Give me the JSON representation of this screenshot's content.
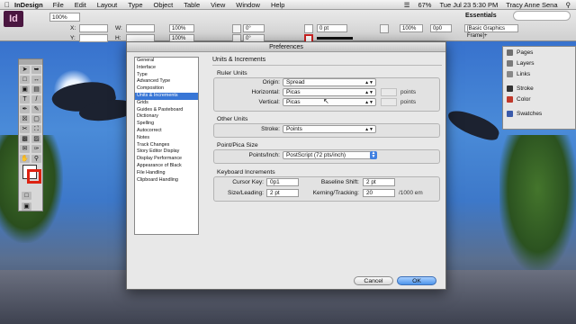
{
  "menubar": {
    "app_name": "InDesign",
    "items": [
      "File",
      "Edit",
      "Layout",
      "Type",
      "Object",
      "Table",
      "View",
      "Window",
      "Help"
    ],
    "battery": "67%",
    "clock": "Tue Jul 23  5:30 PM",
    "user": "Tracy Anne Sena"
  },
  "control": {
    "logo": "Id",
    "zoom": "100%",
    "workspace": "Essentials",
    "x_label": "X:",
    "y_label": "Y:",
    "w_label": "W:",
    "h_label": "H:",
    "scale_x": "100%",
    "scale_y": "100%",
    "rotate": "0°",
    "shear": "0°",
    "stroke_weight": "0 pt",
    "percent": "100%",
    "value_0p0": "0p0",
    "frame_style": "[Basic Graphics Frame]+"
  },
  "right_panels": {
    "group1": [
      {
        "label": "Pages",
        "icon": "pages-icon"
      },
      {
        "label": "Layers",
        "icon": "layers-icon"
      },
      {
        "label": "Links",
        "icon": "links-icon"
      }
    ],
    "group2": [
      {
        "label": "Stroke",
        "icon": "stroke-icon"
      },
      {
        "label": "Color",
        "icon": "color-icon"
      }
    ],
    "group3": [
      {
        "label": "Swatches",
        "icon": "swatches-icon"
      }
    ]
  },
  "dialog": {
    "title": "Preferences",
    "categories": [
      "General",
      "Interface",
      "Type",
      "Advanced Type",
      "Composition",
      "Units & Increments",
      "Grids",
      "Guides & Pasteboard",
      "Dictionary",
      "Spelling",
      "Autocorrect",
      "Notes",
      "Track Changes",
      "Story Editor Display",
      "Display Performance",
      "Appearance of Black",
      "File Handling",
      "Clipboard Handling"
    ],
    "selected_category": "Units & Increments",
    "section_title": "Units & Increments",
    "ruler_units": {
      "legend": "Ruler Units",
      "origin_label": "Origin:",
      "origin_value": "Spread",
      "horizontal_label": "Horizontal:",
      "horizontal_value": "Picas",
      "horizontal_unit": "points",
      "vertical_label": "Vertical:",
      "vertical_value": "Picas",
      "vertical_unit": "points"
    },
    "other_units": {
      "legend": "Other Units",
      "stroke_label": "Stroke:",
      "stroke_value": "Points"
    },
    "point_pica": {
      "legend": "Point/Pica Size",
      "label": "Points/Inch:",
      "value": "PostScript (72 pts/inch)"
    },
    "keyboard": {
      "legend": "Keyboard Increments",
      "cursor_label": "Cursor Key:",
      "cursor_value": "0p1",
      "baseline_label": "Baseline Shift:",
      "baseline_value": "2 pt",
      "size_label": "Size/Leading:",
      "size_value": "2 pt",
      "kerning_label": "Kerning/Tracking:",
      "kerning_value": "20",
      "kerning_unit": "/1000 em"
    },
    "cancel_label": "Cancel",
    "ok_label": "OK"
  }
}
